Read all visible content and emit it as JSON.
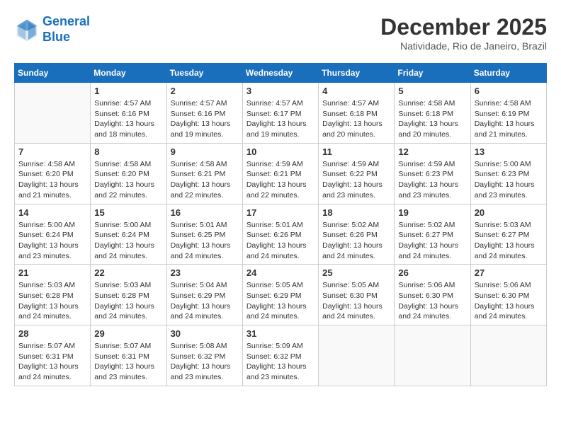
{
  "header": {
    "logo_line1": "General",
    "logo_line2": "Blue",
    "month": "December 2025",
    "location": "Natividade, Rio de Janeiro, Brazil"
  },
  "weekdays": [
    "Sunday",
    "Monday",
    "Tuesday",
    "Wednesday",
    "Thursday",
    "Friday",
    "Saturday"
  ],
  "weeks": [
    [
      {
        "day": "",
        "text": ""
      },
      {
        "day": "1",
        "text": "Sunrise: 4:57 AM\nSunset: 6:16 PM\nDaylight: 13 hours\nand 18 minutes."
      },
      {
        "day": "2",
        "text": "Sunrise: 4:57 AM\nSunset: 6:16 PM\nDaylight: 13 hours\nand 19 minutes."
      },
      {
        "day": "3",
        "text": "Sunrise: 4:57 AM\nSunset: 6:17 PM\nDaylight: 13 hours\nand 19 minutes."
      },
      {
        "day": "4",
        "text": "Sunrise: 4:57 AM\nSunset: 6:18 PM\nDaylight: 13 hours\nand 20 minutes."
      },
      {
        "day": "5",
        "text": "Sunrise: 4:58 AM\nSunset: 6:18 PM\nDaylight: 13 hours\nand 20 minutes."
      },
      {
        "day": "6",
        "text": "Sunrise: 4:58 AM\nSunset: 6:19 PM\nDaylight: 13 hours\nand 21 minutes."
      }
    ],
    [
      {
        "day": "7",
        "text": "Sunrise: 4:58 AM\nSunset: 6:20 PM\nDaylight: 13 hours\nand 21 minutes."
      },
      {
        "day": "8",
        "text": "Sunrise: 4:58 AM\nSunset: 6:20 PM\nDaylight: 13 hours\nand 22 minutes."
      },
      {
        "day": "9",
        "text": "Sunrise: 4:58 AM\nSunset: 6:21 PM\nDaylight: 13 hours\nand 22 minutes."
      },
      {
        "day": "10",
        "text": "Sunrise: 4:59 AM\nSunset: 6:21 PM\nDaylight: 13 hours\nand 22 minutes."
      },
      {
        "day": "11",
        "text": "Sunrise: 4:59 AM\nSunset: 6:22 PM\nDaylight: 13 hours\nand 23 minutes."
      },
      {
        "day": "12",
        "text": "Sunrise: 4:59 AM\nSunset: 6:23 PM\nDaylight: 13 hours\nand 23 minutes."
      },
      {
        "day": "13",
        "text": "Sunrise: 5:00 AM\nSunset: 6:23 PM\nDaylight: 13 hours\nand 23 minutes."
      }
    ],
    [
      {
        "day": "14",
        "text": "Sunrise: 5:00 AM\nSunset: 6:24 PM\nDaylight: 13 hours\nand 23 minutes."
      },
      {
        "day": "15",
        "text": "Sunrise: 5:00 AM\nSunset: 6:24 PM\nDaylight: 13 hours\nand 24 minutes."
      },
      {
        "day": "16",
        "text": "Sunrise: 5:01 AM\nSunset: 6:25 PM\nDaylight: 13 hours\nand 24 minutes."
      },
      {
        "day": "17",
        "text": "Sunrise: 5:01 AM\nSunset: 6:26 PM\nDaylight: 13 hours\nand 24 minutes."
      },
      {
        "day": "18",
        "text": "Sunrise: 5:02 AM\nSunset: 6:26 PM\nDaylight: 13 hours\nand 24 minutes."
      },
      {
        "day": "19",
        "text": "Sunrise: 5:02 AM\nSunset: 6:27 PM\nDaylight: 13 hours\nand 24 minutes."
      },
      {
        "day": "20",
        "text": "Sunrise: 5:03 AM\nSunset: 6:27 PM\nDaylight: 13 hours\nand 24 minutes."
      }
    ],
    [
      {
        "day": "21",
        "text": "Sunrise: 5:03 AM\nSunset: 6:28 PM\nDaylight: 13 hours\nand 24 minutes."
      },
      {
        "day": "22",
        "text": "Sunrise: 5:03 AM\nSunset: 6:28 PM\nDaylight: 13 hours\nand 24 minutes."
      },
      {
        "day": "23",
        "text": "Sunrise: 5:04 AM\nSunset: 6:29 PM\nDaylight: 13 hours\nand 24 minutes."
      },
      {
        "day": "24",
        "text": "Sunrise: 5:05 AM\nSunset: 6:29 PM\nDaylight: 13 hours\nand 24 minutes."
      },
      {
        "day": "25",
        "text": "Sunrise: 5:05 AM\nSunset: 6:30 PM\nDaylight: 13 hours\nand 24 minutes."
      },
      {
        "day": "26",
        "text": "Sunrise: 5:06 AM\nSunset: 6:30 PM\nDaylight: 13 hours\nand 24 minutes."
      },
      {
        "day": "27",
        "text": "Sunrise: 5:06 AM\nSunset: 6:30 PM\nDaylight: 13 hours\nand 24 minutes."
      }
    ],
    [
      {
        "day": "28",
        "text": "Sunrise: 5:07 AM\nSunset: 6:31 PM\nDaylight: 13 hours\nand 24 minutes."
      },
      {
        "day": "29",
        "text": "Sunrise: 5:07 AM\nSunset: 6:31 PM\nDaylight: 13 hours\nand 23 minutes."
      },
      {
        "day": "30",
        "text": "Sunrise: 5:08 AM\nSunset: 6:32 PM\nDaylight: 13 hours\nand 23 minutes."
      },
      {
        "day": "31",
        "text": "Sunrise: 5:09 AM\nSunset: 6:32 PM\nDaylight: 13 hours\nand 23 minutes."
      },
      {
        "day": "",
        "text": ""
      },
      {
        "day": "",
        "text": ""
      },
      {
        "day": "",
        "text": ""
      }
    ]
  ]
}
